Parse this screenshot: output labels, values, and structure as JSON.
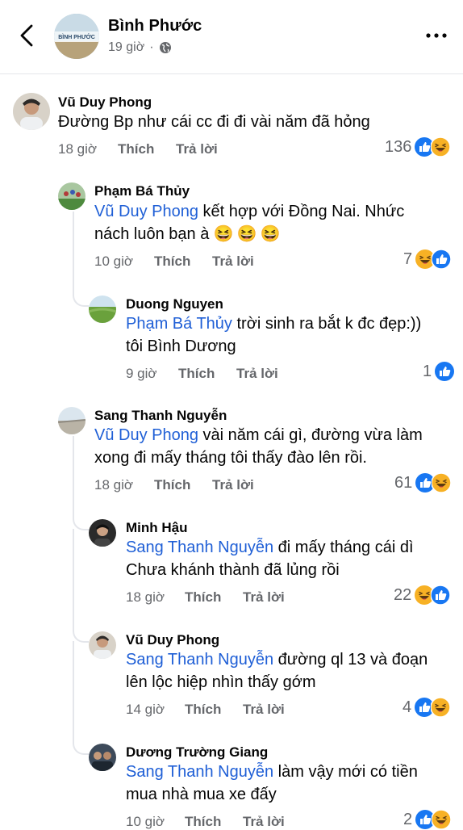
{
  "header": {
    "title": "Bình Phước",
    "time": "19 giờ",
    "avatar_text": "BÌNH PHƯỚC"
  },
  "labels": {
    "like": "Thích",
    "reply": "Trả lời"
  },
  "comments": [
    {
      "author": "Vũ Duy Phong",
      "mention": "",
      "line1": "Đường Bp như cái cc đi đi vài năm đã hỏng",
      "line2": "",
      "time": "18 giờ",
      "count": "136"
    },
    {
      "author": "Phạm Bá Thủy",
      "mention": "Vũ Duy Phong",
      "line1": " kết hợp với Đồng Nai. Nhức",
      "line2": "nách luôn bạn à",
      "emoji": "😆😆😆",
      "time": "10 giờ",
      "count": "7"
    },
    {
      "author": "Duong Nguyen",
      "mention": "Phạm Bá Thủy",
      "line1": " trời sinh ra bắt k đc đẹp:))",
      "line2": "tôi Bình Dương",
      "time": "9 giờ",
      "count": "1"
    },
    {
      "author": "Sang Thanh Nguyễn",
      "mention": "Vũ Duy Phong",
      "line1": " vài năm cái gì, đường vừa làm",
      "line2": "xong đi mấy tháng tôi thấy đào lên rồi.",
      "time": "18 giờ",
      "count": "61"
    },
    {
      "author": "Minh Hậu",
      "mention": "Sang Thanh Nguyễn",
      "line1": " đi mấy tháng cái dì",
      "line2": "Chưa khánh thành đã lủng rồi",
      "time": "18 giờ",
      "count": "22"
    },
    {
      "author": "Vũ Duy Phong",
      "mention": "Sang Thanh Nguyễn",
      "line1": " đường ql 13 và đoạn",
      "line2": "lên lộc hiệp nhìn thấy gớm",
      "time": "14 giờ",
      "count": "4"
    },
    {
      "author": "Dương Trường Giang",
      "mention": "Sang Thanh Nguyễn",
      "line1": " làm vậy mới có tiền",
      "line2": "mua nhà mua xe đấy",
      "time": "10 giờ",
      "count": "2"
    }
  ],
  "colors": {
    "mention": "#1f5fd6",
    "like": "#1877f2",
    "haha": "#f7b125",
    "muted": "#65676b"
  }
}
